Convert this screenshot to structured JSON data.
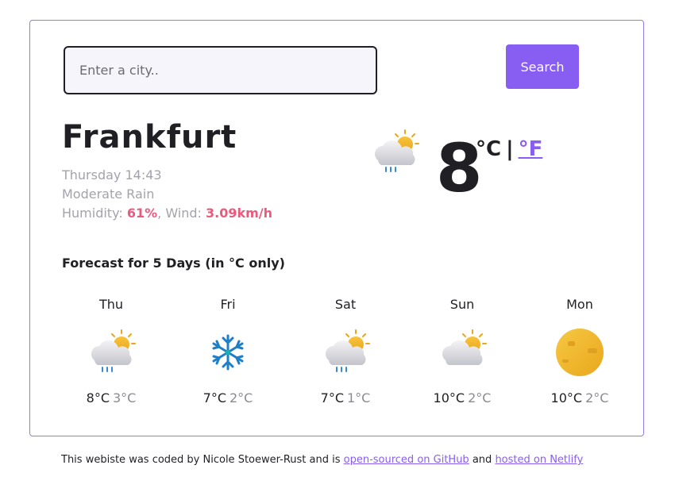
{
  "search": {
    "placeholder": "Enter a city..",
    "value": "",
    "button_label": "Search"
  },
  "current": {
    "city": "Frankfurt",
    "day_time": "Thursday 14:43",
    "description": "Moderate Rain",
    "humidity_label": "Humidity: ",
    "humidity_value": "61%",
    "wind_label": ", Wind: ",
    "wind_value": "3.09km/h",
    "temperature": "8",
    "unit_celsius": "°C",
    "unit_separator": "|",
    "unit_fahrenheit": "°F",
    "icon": "rain-sun-cloud-icon"
  },
  "forecast": {
    "title": "Forecast for 5 Days (in °C only)",
    "days": [
      {
        "day": "Thu",
        "max": "8°C",
        "min": "3°C",
        "icon": "rain-sun-cloud-icon"
      },
      {
        "day": "Fri",
        "max": "7°C",
        "min": "2°C",
        "icon": "snowflake-icon"
      },
      {
        "day": "Sat",
        "max": "7°C",
        "min": "1°C",
        "icon": "rain-sun-cloud-icon"
      },
      {
        "day": "Sun",
        "max": "10°C",
        "min": "2°C",
        "icon": "sun-cloud-icon"
      },
      {
        "day": "Mon",
        "max": "10°C",
        "min": "2°C",
        "icon": "moon-icon"
      }
    ]
  },
  "footer": {
    "text_before": "This webiste was coded by Nicole Stoewer-Rust and is ",
    "github_link": "open-sourced on GitHub",
    "text_middle": " and ",
    "netlify_link": "hosted on Netlify"
  },
  "colors": {
    "accent": "#885df1",
    "highlight": "#ea5a7d",
    "muted": "#a3a3ab",
    "text": "#1f1f24"
  }
}
